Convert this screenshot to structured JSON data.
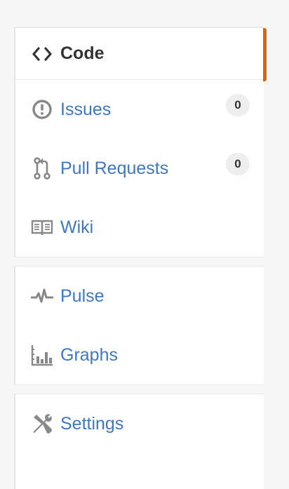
{
  "nav": {
    "primary": {
      "code": {
        "label": "Code",
        "icon": "code-icon"
      },
      "issues": {
        "label": "Issues",
        "icon": "issue-opened-icon",
        "count": "0"
      },
      "pulls": {
        "label": "Pull Requests",
        "icon": "git-pull-request-icon",
        "count": "0"
      },
      "wiki": {
        "label": "Wiki",
        "icon": "book-icon"
      }
    },
    "secondary": {
      "pulse": {
        "label": "Pulse",
        "icon": "pulse-icon"
      },
      "graphs": {
        "label": "Graphs",
        "icon": "graph-icon"
      }
    },
    "tertiary": {
      "settings": {
        "label": "Settings",
        "icon": "tools-icon"
      }
    }
  },
  "colors": {
    "link": "#4078c0",
    "selected_text": "#333333",
    "selected_indicator": "#d26911",
    "icon": "#888888",
    "counter_bg": "#eeeeee"
  }
}
